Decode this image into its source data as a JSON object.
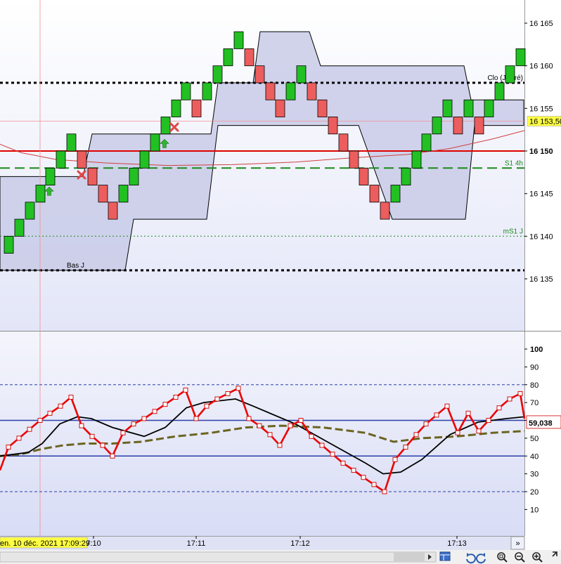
{
  "colors": {
    "bg_top": "#ffffff",
    "bg_bottom": "#dde1f7",
    "band": "#c9cbe8",
    "up": "#22c022",
    "down": "#ec5d5d",
    "red_line": "#e00000",
    "green_line": "#1a8a1a",
    "osc": "#ee0000",
    "signal": "#000000",
    "trend": "#6b6420",
    "price_tag_bg": "#ffff44",
    "osc_tag": "#cc0000"
  },
  "chart_data": [
    {
      "type": "renko",
      "ylim": [
        16130,
        16168
      ],
      "y_ticks": [
        "16 165",
        "16 160",
        "16 155",
        "16 150",
        "16 145",
        "16 140",
        "16 135"
      ],
      "y_tick_values": [
        16165,
        16160,
        16155,
        16150,
        16145,
        16140,
        16135
      ],
      "bars": [
        {
          "x": 12,
          "dir": "up",
          "lo": 16138,
          "hi": 16140
        },
        {
          "x": 27,
          "dir": "up",
          "lo": 16140,
          "hi": 16142
        },
        {
          "x": 42,
          "dir": "up",
          "lo": 16142,
          "hi": 16144
        },
        {
          "x": 57,
          "dir": "up",
          "lo": 16144,
          "hi": 16146
        },
        {
          "x": 71,
          "dir": "up",
          "lo": 16146,
          "hi": 16148
        },
        {
          "x": 86,
          "dir": "up",
          "lo": 16148,
          "hi": 16150
        },
        {
          "x": 101,
          "dir": "up",
          "lo": 16150,
          "hi": 16152
        },
        {
          "x": 116,
          "dir": "down",
          "lo": 16148,
          "hi": 16150
        },
        {
          "x": 131,
          "dir": "down",
          "lo": 16146,
          "hi": 16148
        },
        {
          "x": 146,
          "dir": "down",
          "lo": 16144,
          "hi": 16146
        },
        {
          "x": 160,
          "dir": "down",
          "lo": 16142,
          "hi": 16144
        },
        {
          "x": 175,
          "dir": "up",
          "lo": 16144,
          "hi": 16146
        },
        {
          "x": 190,
          "dir": "up",
          "lo": 16146,
          "hi": 16148
        },
        {
          "x": 205,
          "dir": "up",
          "lo": 16148,
          "hi": 16150
        },
        {
          "x": 220,
          "dir": "up",
          "lo": 16150,
          "hi": 16152
        },
        {
          "x": 235,
          "dir": "up",
          "lo": 16152,
          "hi": 16154
        },
        {
          "x": 250,
          "dir": "up",
          "lo": 16154,
          "hi": 16156
        },
        {
          "x": 264,
          "dir": "up",
          "lo": 16156,
          "hi": 16158
        },
        {
          "x": 279,
          "dir": "down",
          "lo": 16154,
          "hi": 16156
        },
        {
          "x": 294,
          "dir": "up",
          "lo": 16156,
          "hi": 16158
        },
        {
          "x": 309,
          "dir": "up",
          "lo": 16158,
          "hi": 16160
        },
        {
          "x": 324,
          "dir": "up",
          "lo": 16160,
          "hi": 16162
        },
        {
          "x": 339,
          "dir": "up",
          "lo": 16162,
          "hi": 16164
        },
        {
          "x": 354,
          "dir": "down",
          "lo": 16160,
          "hi": 16162
        },
        {
          "x": 369,
          "dir": "down",
          "lo": 16158,
          "hi": 16160
        },
        {
          "x": 384,
          "dir": "down",
          "lo": 16156,
          "hi": 16158
        },
        {
          "x": 398,
          "dir": "down",
          "lo": 16154,
          "hi": 16156
        },
        {
          "x": 413,
          "dir": "up",
          "lo": 16156,
          "hi": 16158
        },
        {
          "x": 428,
          "dir": "up",
          "lo": 16158,
          "hi": 16160
        },
        {
          "x": 443,
          "dir": "down",
          "lo": 16156,
          "hi": 16158
        },
        {
          "x": 458,
          "dir": "down",
          "lo": 16154,
          "hi": 16156
        },
        {
          "x": 473,
          "dir": "down",
          "lo": 16152,
          "hi": 16154
        },
        {
          "x": 488,
          "dir": "down",
          "lo": 16150,
          "hi": 16152
        },
        {
          "x": 503,
          "dir": "down",
          "lo": 16148,
          "hi": 16150
        },
        {
          "x": 517,
          "dir": "down",
          "lo": 16146,
          "hi": 16148
        },
        {
          "x": 532,
          "dir": "down",
          "lo": 16144,
          "hi": 16146
        },
        {
          "x": 547,
          "dir": "down",
          "lo": 16142,
          "hi": 16144
        },
        {
          "x": 562,
          "dir": "up",
          "lo": 16144,
          "hi": 16146
        },
        {
          "x": 577,
          "dir": "up",
          "lo": 16146,
          "hi": 16148
        },
        {
          "x": 592,
          "dir": "up",
          "lo": 16148,
          "hi": 16150
        },
        {
          "x": 606,
          "dir": "up",
          "lo": 16150,
          "hi": 16152
        },
        {
          "x": 621,
          "dir": "up",
          "lo": 16152,
          "hi": 16154
        },
        {
          "x": 636,
          "dir": "up",
          "lo": 16154,
          "hi": 16156
        },
        {
          "x": 651,
          "dir": "down",
          "lo": 16152,
          "hi": 16154
        },
        {
          "x": 666,
          "dir": "up",
          "lo": 16154,
          "hi": 16156
        },
        {
          "x": 681,
          "dir": "down",
          "lo": 16152,
          "hi": 16154
        },
        {
          "x": 695,
          "dir": "up",
          "lo": 16154,
          "hi": 16156
        },
        {
          "x": 710,
          "dir": "up",
          "lo": 16156,
          "hi": 16158
        },
        {
          "x": 725,
          "dir": "up",
          "lo": 16158,
          "hi": 16160
        },
        {
          "x": 740,
          "dir": "up",
          "lo": 16160,
          "hi": 16162
        }
      ],
      "band_upper": [
        [
          0,
          16147
        ],
        [
          18,
          16147
        ],
        [
          63,
          16147
        ],
        [
          118,
          16147
        ],
        [
          131,
          16152
        ],
        [
          300,
          16152
        ],
        [
          310,
          16158
        ],
        [
          360,
          16158
        ],
        [
          370,
          16164
        ],
        [
          440,
          16164
        ],
        [
          456,
          16160
        ],
        [
          660,
          16160
        ],
        [
          670,
          16156
        ],
        [
          745,
          16156
        ]
      ],
      "band_lower": [
        [
          745,
          16153
        ],
        [
          675,
          16153
        ],
        [
          662,
          16142
        ],
        [
          575,
          16142
        ],
        [
          565,
          16142
        ],
        [
          558,
          16142
        ],
        [
          510,
          16153
        ],
        [
          310,
          16153
        ],
        [
          294,
          16142
        ],
        [
          190,
          16142
        ],
        [
          178,
          16136
        ],
        [
          20,
          16136
        ],
        [
          0,
          16136
        ]
      ],
      "levels": [
        {
          "name": "Clo (J, Pré)",
          "value": 16158,
          "style": "dotted",
          "color": "#000000"
        },
        {
          "name": "S1 4h",
          "value": 16148,
          "style": "dashed",
          "color": "#1a8a1a"
        },
        {
          "name": "mS1 J",
          "value": 16140,
          "style": "dotted",
          "color": "#1a8a1a"
        },
        {
          "name": "Bas J",
          "value": 16136,
          "style": "dotted",
          "color": "#000000"
        },
        {
          "name": "",
          "value": 16150,
          "style": "solid",
          "color": "#e00000"
        }
      ],
      "ma": [
        [
          0,
          16150.8
        ],
        [
          30,
          16149.8
        ],
        [
          80,
          16149
        ],
        [
          150,
          16148.6
        ],
        [
          240,
          16148.3
        ],
        [
          330,
          16148.4
        ],
        [
          420,
          16148.7
        ],
        [
          500,
          16149.2
        ],
        [
          580,
          16149.6
        ],
        [
          640,
          16150.3
        ],
        [
          700,
          16151.4
        ],
        [
          746,
          16152.4
        ]
      ],
      "crosshair_price": "16 153,50",
      "crosshair_value": 16153.5,
      "markers": [
        {
          "type": "buy",
          "x": 70,
          "value": 16145.2
        },
        {
          "type": "buy",
          "x": 234,
          "value": 16150.8
        },
        {
          "type": "sell",
          "x": 116,
          "value": 16147.2
        },
        {
          "type": "sell",
          "x": 248,
          "value": 16152.8
        }
      ]
    },
    {
      "type": "line",
      "ylim": [
        0,
        107
      ],
      "y_ticks": [
        "100",
        "90",
        "80",
        "70",
        "60",
        "50",
        "40",
        "30",
        "20",
        "10"
      ],
      "y_tick_values": [
        100,
        90,
        80,
        70,
        60,
        50,
        40,
        30,
        20,
        10
      ],
      "levels_dashed": [
        80,
        20
      ],
      "levels_solid": [
        60,
        40
      ],
      "last_value_label": "59,038",
      "last_value": 59.038,
      "series": [
        {
          "role": "oscillator",
          "x": [
            0,
            12,
            27,
            42,
            57,
            71,
            86,
            101,
            116,
            131,
            146,
            160,
            175,
            190,
            205,
            220,
            235,
            250,
            264,
            279,
            294,
            309,
            324,
            339,
            354,
            369,
            384,
            398,
            413,
            428,
            443,
            458,
            473,
            488,
            503,
            517,
            532,
            547,
            562,
            577,
            592,
            606,
            621,
            636,
            651,
            666,
            681,
            695,
            710,
            725,
            740,
            746
          ],
          "values": [
            32,
            45,
            50,
            55,
            60,
            64,
            68,
            73,
            57,
            51,
            46,
            40,
            53,
            58,
            61,
            65,
            69,
            73,
            77,
            61,
            68,
            72,
            75,
            78,
            61,
            57,
            52,
            46,
            57,
            60,
            51,
            46,
            41,
            36,
            32,
            28,
            24,
            20,
            38,
            45,
            52,
            58,
            63,
            68,
            53,
            64,
            54,
            60,
            67,
            72,
            75,
            61
          ]
        },
        {
          "role": "signal",
          "x": [
            0,
            40,
            60,
            85,
            110,
            130,
            160,
            205,
            235,
            265,
            290,
            335,
            360,
            420,
            470,
            520,
            545,
            570,
            600,
            640,
            680,
            720,
            746
          ],
          "values": [
            40,
            42,
            47,
            58,
            62,
            61,
            56,
            51,
            56,
            67,
            70,
            72,
            68,
            58,
            47,
            36,
            30,
            31,
            38,
            52,
            59,
            61,
            62
          ]
        },
        {
          "role": "trend",
          "x": [
            0,
            30,
            60,
            90,
            120,
            160,
            200,
            250,
            300,
            350,
            400,
            460,
            520,
            560,
            600,
            650,
            700,
            746
          ],
          "values": [
            40,
            41,
            44,
            46,
            47,
            47,
            48,
            51,
            53,
            56,
            57,
            56,
            53,
            48,
            50,
            51,
            53,
            54
          ]
        }
      ]
    }
  ],
  "time_axis": {
    "ticks": [
      {
        "label": "7:10",
        "x": 133
      },
      {
        "label": "17:11",
        "x": 279
      },
      {
        "label": "17:12",
        "x": 427
      },
      {
        "label": "17:13",
        "x": 650
      }
    ],
    "cursor_label": "en. 10 déc. 2021 17:09:29",
    "cursor_x": 57
  },
  "toolbar": {
    "scroll_end_label": "»",
    "icons": [
      "chart-layout-icon",
      "undo-icon",
      "redo-icon",
      "zoom-reset-icon",
      "zoom-out-icon",
      "zoom-in-icon"
    ]
  }
}
